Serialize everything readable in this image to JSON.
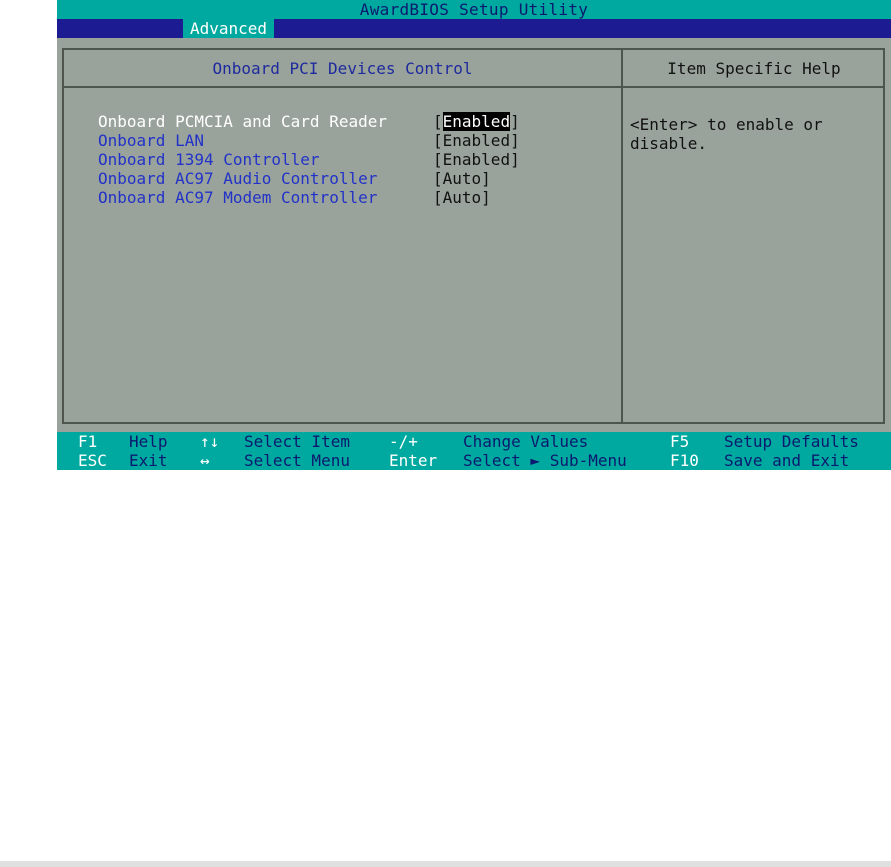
{
  "title": "AwardBIOS Setup Utility",
  "menu": {
    "active_tab": "Advanced"
  },
  "panel": {
    "title": "Onboard PCI Devices Control",
    "items": [
      {
        "label": "Onboard PCMCIA and Card Reader",
        "value": "Enabled"
      },
      {
        "label": "Onboard LAN",
        "value": "Enabled"
      },
      {
        "label": "Onboard 1394 Controller",
        "value": "Enabled"
      },
      {
        "label": "Onboard AC97 Audio Controller",
        "value": "Auto"
      },
      {
        "label": "Onboard AC97 Modem Controller",
        "value": "Auto"
      }
    ]
  },
  "help": {
    "title": "Item Specific Help",
    "text": "<Enter> to enable or\ndisable."
  },
  "footer": {
    "row1": [
      {
        "key": "F1",
        "desc": "Help"
      },
      {
        "key": "↑↓",
        "desc": "Select Item"
      },
      {
        "key": "-/+",
        "desc": "Change Values"
      },
      {
        "key": "F5",
        "desc": "Setup Defaults"
      }
    ],
    "row2": [
      {
        "key": "ESC",
        "desc": "Exit"
      },
      {
        "key": "↔",
        "desc": "Select Menu"
      },
      {
        "key": "Enter",
        "desc": "Select ► Sub-Menu"
      },
      {
        "key": "F10",
        "desc": "Save and Exit"
      }
    ]
  },
  "colors": {
    "cyan_bar": "#00a9a0",
    "menu_blue": "#1d1b91",
    "panel_gray": "#9aa39b",
    "item_blue": "#2232c8"
  }
}
